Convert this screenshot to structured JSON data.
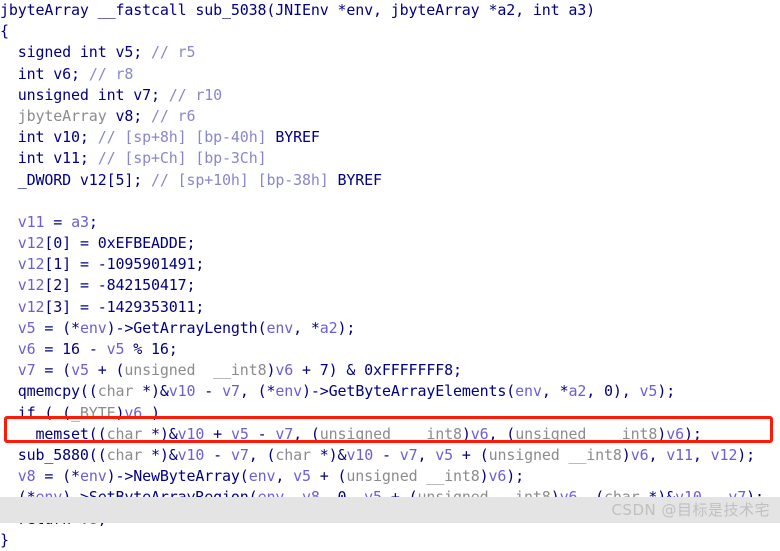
{
  "editor": {
    "name": "hexrays-pseudocode-view",
    "background": "#ffffff",
    "font_size_px": 15,
    "line_height_px": 21.2
  },
  "colors": {
    "keyword": "#000080",
    "type_gray": "#8c8c8c",
    "local_var": "#6b5ed6",
    "comment": "#8a87c9",
    "function": "#0000c0",
    "highlight_box": "#ff1a05",
    "watermark_band": "#e4e4e4",
    "watermark_text": "#c0c0c0"
  },
  "code": {
    "lines": [
      {
        "index": 0,
        "text": "jbyteArray __fastcall sub_5038(JNIEnv *env, jbyteArray *a2, int a3)",
        "tokens": [
          {
            "t": "jbyteArray __fastcall sub_5038(JNIEnv *env, jbyteArray *a2, int a3)",
            "c": "t-kw"
          }
        ]
      },
      {
        "index": 1,
        "text": "{",
        "tokens": [
          {
            "t": "{",
            "c": "t-kw"
          }
        ]
      },
      {
        "index": 2,
        "text": "  signed int v5; // r5",
        "tokens": [
          {
            "t": "  signed int v5; ",
            "c": "t-kw"
          },
          {
            "t": "// r5",
            "c": "t-cmt"
          }
        ]
      },
      {
        "index": 3,
        "text": "  int v6; // r8",
        "tokens": [
          {
            "t": "  int v6; ",
            "c": "t-kw"
          },
          {
            "t": "// r8",
            "c": "t-cmt"
          }
        ]
      },
      {
        "index": 4,
        "text": "  unsigned int v7; // r10",
        "tokens": [
          {
            "t": "  unsigned int v7; ",
            "c": "t-kw"
          },
          {
            "t": "// r10",
            "c": "t-cmt"
          }
        ]
      },
      {
        "index": 5,
        "text": "  jbyteArray v8; // r6",
        "tokens": [
          {
            "t": "  ",
            "c": "t-kw"
          },
          {
            "t": "jbyteArray",
            "c": "t-type"
          },
          {
            "t": " v8; ",
            "c": "t-kw"
          },
          {
            "t": "// r6",
            "c": "t-cmt"
          }
        ]
      },
      {
        "index": 6,
        "text": "  int v10; // [sp+8h] [bp-40h] BYREF",
        "tokens": [
          {
            "t": "  int v10; ",
            "c": "t-kw"
          },
          {
            "t": "// ",
            "c": "t-cmt"
          },
          {
            "t": "[sp+8h] [bp-40h]",
            "c": "t-cmt"
          },
          {
            "t": " BYREF",
            "c": "t-kw"
          }
        ]
      },
      {
        "index": 7,
        "text": "  int v11; // [sp+Ch] [bp-3Ch]",
        "tokens": [
          {
            "t": "  int v11; ",
            "c": "t-kw"
          },
          {
            "t": "// ",
            "c": "t-cmt"
          },
          {
            "t": "[sp+Ch] [bp-3Ch]",
            "c": "t-cmt"
          }
        ]
      },
      {
        "index": 8,
        "text": "  _DWORD v12[5]; // [sp+10h] [bp-38h] BYREF",
        "tokens": [
          {
            "t": "  _DWORD v12[5]; ",
            "c": "t-kw"
          },
          {
            "t": "// ",
            "c": "t-cmt"
          },
          {
            "t": "[sp+10h] [bp-38h]",
            "c": "t-cmt"
          },
          {
            "t": " BYREF",
            "c": "t-kw"
          }
        ]
      },
      {
        "index": 9,
        "text": "",
        "tokens": [
          {
            "t": " ",
            "c": "t-kw"
          }
        ]
      },
      {
        "index": 10,
        "text": "  v11 = a3;",
        "tokens": [
          {
            "t": "  ",
            "c": "t-kw"
          },
          {
            "t": "v11",
            "c": "t-var"
          },
          {
            "t": " = ",
            "c": "t-kw"
          },
          {
            "t": "a3",
            "c": "t-arg"
          },
          {
            "t": ";",
            "c": "t-kw"
          }
        ]
      },
      {
        "index": 11,
        "text": "  v12[0] = 0xEFBEADDE;",
        "tokens": [
          {
            "t": "  ",
            "c": "t-kw"
          },
          {
            "t": "v12",
            "c": "t-var"
          },
          {
            "t": "[0] = 0xEFBEADDE;",
            "c": "t-kw"
          }
        ]
      },
      {
        "index": 12,
        "text": "  v12[1] = -1095901491;",
        "tokens": [
          {
            "t": "  ",
            "c": "t-kw"
          },
          {
            "t": "v12",
            "c": "t-var"
          },
          {
            "t": "[1] = -1095901491;",
            "c": "t-kw"
          }
        ]
      },
      {
        "index": 13,
        "text": "  v12[2] = -842150417;",
        "tokens": [
          {
            "t": "  ",
            "c": "t-kw"
          },
          {
            "t": "v12",
            "c": "t-var"
          },
          {
            "t": "[2] = -842150417;",
            "c": "t-kw"
          }
        ]
      },
      {
        "index": 14,
        "text": "  v12[3] = -1429353011;",
        "tokens": [
          {
            "t": "  ",
            "c": "t-kw"
          },
          {
            "t": "v12",
            "c": "t-var"
          },
          {
            "t": "[3] = -1429353011;",
            "c": "t-kw"
          }
        ]
      },
      {
        "index": 15,
        "text": "  v5 = (*env)->GetArrayLength(env, *a2);",
        "tokens": [
          {
            "t": "  ",
            "c": "t-kw"
          },
          {
            "t": "v5",
            "c": "t-var"
          },
          {
            "t": " = (*",
            "c": "t-kw"
          },
          {
            "t": "env",
            "c": "t-arg"
          },
          {
            "t": ")->GetArrayLength(",
            "c": "t-kw"
          },
          {
            "t": "env",
            "c": "t-arg"
          },
          {
            "t": ", *",
            "c": "t-kw"
          },
          {
            "t": "a2",
            "c": "t-arg"
          },
          {
            "t": ");",
            "c": "t-kw"
          }
        ]
      },
      {
        "index": 16,
        "text": "  v6 = 16 - v5 % 16;",
        "tokens": [
          {
            "t": "  ",
            "c": "t-kw"
          },
          {
            "t": "v6",
            "c": "t-var"
          },
          {
            "t": " = 16 - ",
            "c": "t-kw"
          },
          {
            "t": "v5",
            "c": "t-var"
          },
          {
            "t": " % 16;",
            "c": "t-kw"
          }
        ]
      },
      {
        "index": 17,
        "text": "  v7 = (v5 + (unsigned __int8)v6 + 7) & 0xFFFFFFF8;",
        "tokens": [
          {
            "t": "  ",
            "c": "t-kw"
          },
          {
            "t": "v7",
            "c": "t-var"
          },
          {
            "t": " = (",
            "c": "t-kw"
          },
          {
            "t": "v5",
            "c": "t-var"
          },
          {
            "t": " + (",
            "c": "t-kw"
          },
          {
            "t": "unsigned  __int8",
            "c": "t-type"
          },
          {
            "t": ")",
            "c": "t-kw"
          },
          {
            "t": "v6",
            "c": "t-var"
          },
          {
            "t": " + 7) & 0xFFFFFFF8;",
            "c": "t-kw"
          }
        ]
      },
      {
        "index": 18,
        "text": "  qmemcpy((char *)&v10 - v7, (*env)->GetByteArrayElements(env, *a2, 0), v5);",
        "tokens": [
          {
            "t": "  qmemcpy((",
            "c": "t-kw"
          },
          {
            "t": "char",
            "c": "t-type"
          },
          {
            "t": " *)&",
            "c": "t-kw"
          },
          {
            "t": "v10",
            "c": "t-var"
          },
          {
            "t": " - ",
            "c": "t-kw"
          },
          {
            "t": "v7",
            "c": "t-var"
          },
          {
            "t": ", (*",
            "c": "t-kw"
          },
          {
            "t": "env",
            "c": "t-arg"
          },
          {
            "t": ")->GetByteArrayElements(",
            "c": "t-kw"
          },
          {
            "t": "env",
            "c": "t-arg"
          },
          {
            "t": ", *",
            "c": "t-kw"
          },
          {
            "t": "a2",
            "c": "t-arg"
          },
          {
            "t": ", 0), ",
            "c": "t-kw"
          },
          {
            "t": "v5",
            "c": "t-var"
          },
          {
            "t": ");",
            "c": "t-kw"
          }
        ]
      },
      {
        "index": 19,
        "text": "  if ( (_BYTE)v6 )",
        "tokens": [
          {
            "t": "  if ( (",
            "c": "t-kw"
          },
          {
            "t": "_BYTE",
            "c": "t-type"
          },
          {
            "t": ")",
            "c": "t-kw"
          },
          {
            "t": "v6",
            "c": "t-var"
          },
          {
            "t": " )",
            "c": "t-kw"
          }
        ]
      },
      {
        "index": 20,
        "text": "    memset((char *)&v10 + v5 - v7, (unsigned  __int8)v6, (unsigned  __int8)v6);",
        "tokens": [
          {
            "t": "    memset((",
            "c": "t-kw"
          },
          {
            "t": "char",
            "c": "t-type"
          },
          {
            "t": " *)&",
            "c": "t-kw"
          },
          {
            "t": "v10",
            "c": "t-var"
          },
          {
            "t": " + ",
            "c": "t-kw"
          },
          {
            "t": "v5",
            "c": "t-var"
          },
          {
            "t": " - ",
            "c": "t-kw"
          },
          {
            "t": "v7",
            "c": "t-var"
          },
          {
            "t": ", (",
            "c": "t-kw"
          },
          {
            "t": "unsigned  __int8",
            "c": "t-type"
          },
          {
            "t": ")",
            "c": "t-kw"
          },
          {
            "t": "v6",
            "c": "t-var"
          },
          {
            "t": ", (",
            "c": "t-kw"
          },
          {
            "t": "unsigned  __int8",
            "c": "t-type"
          },
          {
            "t": ")",
            "c": "t-kw"
          },
          {
            "t": "v6",
            "c": "t-var"
          },
          {
            "t": ");",
            "c": "t-kw"
          }
        ]
      },
      {
        "index": 21,
        "highlighted": true,
        "text": "  sub_5880((char *)&v10 - v7, (char *)&v10 - v7, v5 + (unsigned __int8)v6, v11, v12);",
        "tokens": [
          {
            "t": "  sub_5880((",
            "c": "t-kw"
          },
          {
            "t": "char",
            "c": "t-type"
          },
          {
            "t": " *)&",
            "c": "t-kw"
          },
          {
            "t": "v10",
            "c": "t-var"
          },
          {
            "t": " - ",
            "c": "t-kw"
          },
          {
            "t": "v7",
            "c": "t-var"
          },
          {
            "t": ", (",
            "c": "t-kw"
          },
          {
            "t": "char",
            "c": "t-type"
          },
          {
            "t": " *)&",
            "c": "t-kw"
          },
          {
            "t": "v10",
            "c": "t-var"
          },
          {
            "t": " - ",
            "c": "t-kw"
          },
          {
            "t": "v7",
            "c": "t-var"
          },
          {
            "t": ", ",
            "c": "t-kw"
          },
          {
            "t": "v5",
            "c": "t-var"
          },
          {
            "t": " + (",
            "c": "t-kw"
          },
          {
            "t": "unsigned __int8",
            "c": "t-type"
          },
          {
            "t": ")",
            "c": "t-kw"
          },
          {
            "t": "v6",
            "c": "t-var"
          },
          {
            "t": ", ",
            "c": "t-kw"
          },
          {
            "t": "v11",
            "c": "t-var"
          },
          {
            "t": ", ",
            "c": "t-kw"
          },
          {
            "t": "v12",
            "c": "t-var"
          },
          {
            "t": ");",
            "c": "t-kw"
          }
        ]
      },
      {
        "index": 22,
        "text": "  v8 = (*env)->NewByteArray(env, v5 + (unsigned __int8)v6);",
        "tokens": [
          {
            "t": "  ",
            "c": "t-kw"
          },
          {
            "t": "v8",
            "c": "t-var"
          },
          {
            "t": " = (*",
            "c": "t-kw"
          },
          {
            "t": "env",
            "c": "t-arg"
          },
          {
            "t": ")->NewByteArray(",
            "c": "t-kw"
          },
          {
            "t": "env",
            "c": "t-arg"
          },
          {
            "t": ", ",
            "c": "t-kw"
          },
          {
            "t": "v5",
            "c": "t-var"
          },
          {
            "t": " + (",
            "c": "t-kw"
          },
          {
            "t": "unsigned __int8",
            "c": "t-type"
          },
          {
            "t": ")",
            "c": "t-kw"
          },
          {
            "t": "v6",
            "c": "t-var"
          },
          {
            "t": ");",
            "c": "t-kw"
          }
        ]
      },
      {
        "index": 23,
        "text": "  (*env)->SetByteArrayRegion(env, v8, 0, v5 + (unsigned __int8)v6, (char *)&v10 - v7);",
        "tokens": [
          {
            "t": "  (*",
            "c": "t-kw"
          },
          {
            "t": "env",
            "c": "t-arg"
          },
          {
            "t": ")->SetByteArrayRegion(",
            "c": "t-kw"
          },
          {
            "t": "env",
            "c": "t-arg"
          },
          {
            "t": ", ",
            "c": "t-kw"
          },
          {
            "t": "v8",
            "c": "t-var"
          },
          {
            "t": ", 0, ",
            "c": "t-kw"
          },
          {
            "t": "v5",
            "c": "t-var"
          },
          {
            "t": " + (",
            "c": "t-kw"
          },
          {
            "t": "unsigned __int8",
            "c": "t-type"
          },
          {
            "t": ")",
            "c": "t-kw"
          },
          {
            "t": "v6",
            "c": "t-var"
          },
          {
            "t": ", (",
            "c": "t-kw"
          },
          {
            "t": "char",
            "c": "t-type"
          },
          {
            "t": " *)&",
            "c": "t-kw"
          },
          {
            "t": "v10",
            "c": "t-var"
          },
          {
            "t": " - ",
            "c": "t-kw"
          },
          {
            "t": "v7",
            "c": "t-var"
          },
          {
            "t": ");",
            "c": "t-kw"
          }
        ]
      },
      {
        "index": 24,
        "text": "  return v8;",
        "tokens": [
          {
            "t": "  return ",
            "c": "t-kw"
          },
          {
            "t": "v8",
            "c": "t-var"
          },
          {
            "t": ";",
            "c": "t-kw"
          }
        ]
      },
      {
        "index": 25,
        "text": "}",
        "tokens": [
          {
            "t": "}",
            "c": "t-kw"
          }
        ]
      }
    ]
  },
  "annotation": {
    "type": "red-rectangle-highlight",
    "target_line_index": 21,
    "color": "#ff1a05"
  },
  "watermark": {
    "text": "CSDN @目标是技术宅"
  }
}
